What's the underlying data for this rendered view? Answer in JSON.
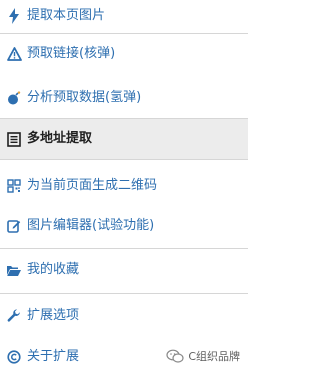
{
  "menu": {
    "items": [
      {
        "label": "提取本页图片",
        "icon": "lightning-icon"
      },
      {
        "label": "预取链接(核弹)",
        "icon": "warning-icon"
      },
      {
        "label": "分析预取数据(氢弹)",
        "icon": "bomb-icon"
      },
      {
        "label": "多地址提取",
        "icon": "list-document-icon"
      },
      {
        "label": "为当前页面生成二维码",
        "icon": "qrcode-icon"
      },
      {
        "label": "图片编辑器(试验功能)",
        "icon": "edit-icon"
      },
      {
        "label": "我的收藏",
        "icon": "folder-open-icon"
      },
      {
        "label": "扩展选项",
        "icon": "wrench-icon"
      },
      {
        "label": "关于扩展",
        "icon": "copyright-icon"
      }
    ]
  },
  "watermark": {
    "text": "C组织品牌",
    "icon": "wechat-icon"
  },
  "colors": {
    "link": "#2e6fb0",
    "active_bg": "#ececec",
    "active_text": "#1f1f1f",
    "divider": "#d6d6d6"
  }
}
